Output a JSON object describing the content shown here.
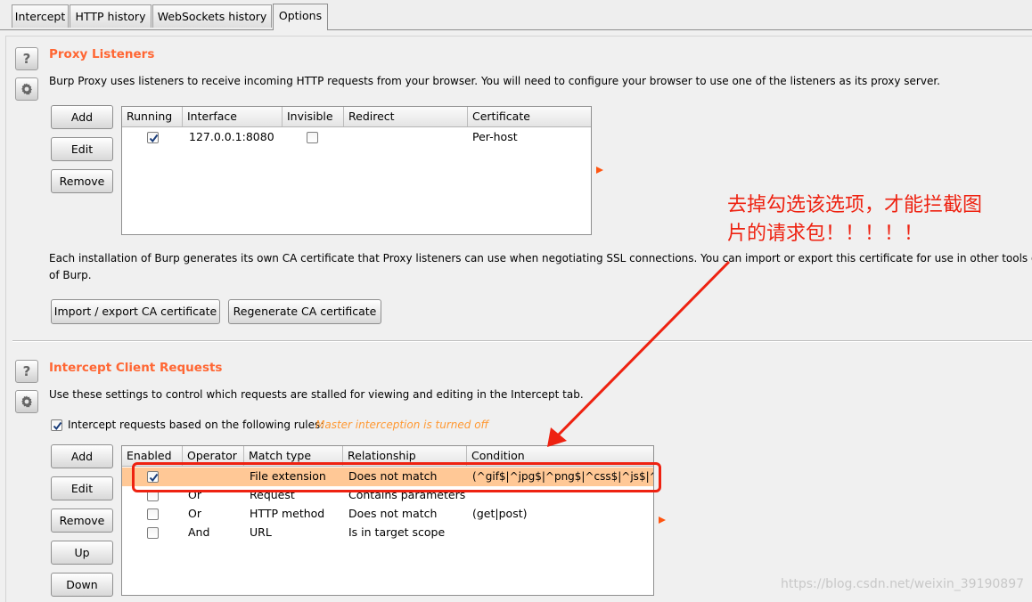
{
  "tabs": [
    {
      "label": "Intercept"
    },
    {
      "label": "HTTP history"
    },
    {
      "label": "WebSockets history"
    },
    {
      "label": "Options"
    }
  ],
  "proxy_listeners": {
    "title": "Proxy Listeners",
    "description": "Burp Proxy uses listeners to receive incoming HTTP requests from your browser. You will need to configure your browser to use one of the listeners as its proxy server.",
    "buttons": {
      "add": "Add",
      "edit": "Edit",
      "remove": "Remove"
    },
    "columns": [
      "Running",
      "Interface",
      "Invisible",
      "Redirect",
      "Certificate"
    ],
    "rows": [
      {
        "running": true,
        "interface": "127.0.0.1:8080",
        "invisible": false,
        "redirect": "",
        "certificate": "Per-host"
      }
    ],
    "ca_text_1": "Each installation of Burp generates its own CA certificate that Proxy listeners can use when negotiating SSL connections. You can import or export this certificate for use in other tools or anot",
    "ca_text_2": "of Burp.",
    "import_export_label": "Import / export CA certificate",
    "regenerate_label": "Regenerate CA certificate"
  },
  "intercept_requests": {
    "title": "Intercept Client Requests",
    "description": "Use these settings to control which requests are stalled for viewing and editing in the Intercept tab.",
    "rules_checkbox_label": "Intercept requests based on the following rules:",
    "rules_checked": true,
    "status_note": "Master interception is turned off",
    "buttons": {
      "add": "Add",
      "edit": "Edit",
      "remove": "Remove",
      "up": "Up",
      "down": "Down"
    },
    "columns": [
      "Enabled",
      "Operator",
      "Match type",
      "Relationship",
      "Condition"
    ],
    "rows": [
      {
        "enabled": true,
        "operator": "",
        "match_type": "File extension",
        "relationship": "Does not match",
        "condition": "(^gif$|^jpg$|^png$|^css$|^js$|^ico$)"
      },
      {
        "enabled": false,
        "operator": "Or",
        "match_type": "Request",
        "relationship": "Contains parameters",
        "condition": ""
      },
      {
        "enabled": false,
        "operator": "Or",
        "match_type": "HTTP method",
        "relationship": "Does not match",
        "condition": "(get|post)"
      },
      {
        "enabled": false,
        "operator": "And",
        "match_type": "URL",
        "relationship": "Is in target scope",
        "condition": ""
      }
    ]
  },
  "annotation": {
    "line1": "去掉勾选该选项，才能拦截图",
    "line2": "片的请求包！！！！！",
    "color": "#ee2211"
  },
  "watermark": "https://blog.csdn.net/weixin_39190897",
  "colors": {
    "section_title": "#ff6633",
    "selected_row": "#ffc896",
    "note": "#ff9933"
  },
  "icons": {
    "help": "question-mark-icon",
    "settings": "gear-icon",
    "check": "checkmark-icon",
    "expand": "triangle-right-icon"
  }
}
